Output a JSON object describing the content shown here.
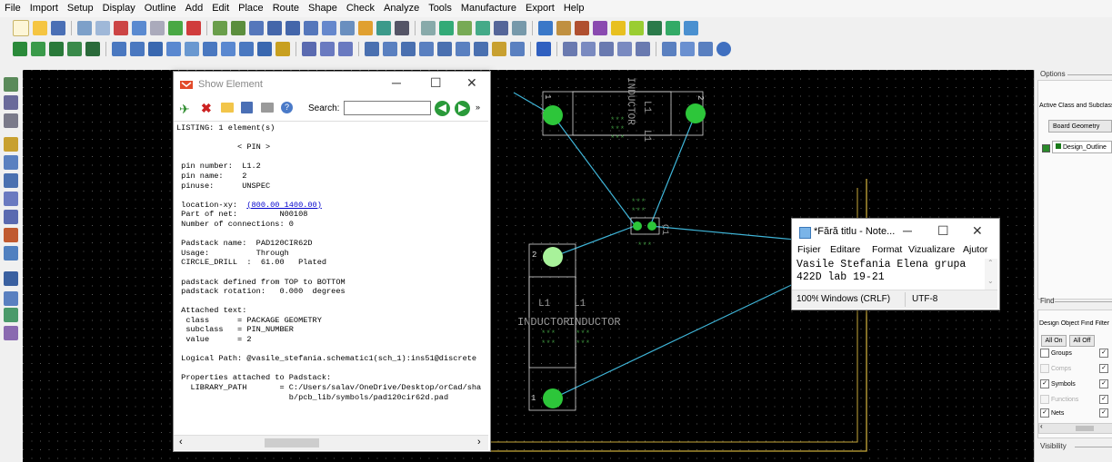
{
  "menu": [
    "File",
    "Import",
    "Setup",
    "Display",
    "Outline",
    "Add",
    "Edit",
    "Place",
    "Route",
    "Shape",
    "Check",
    "Analyze",
    "Tools",
    "Manufacture",
    "Export",
    "Help"
  ],
  "canvas": {
    "upper_inductor": {
      "label_left": "1",
      "label_right": "2",
      "ref_a": "L1",
      "ref_b": "L1",
      "type": "INDUCTOR",
      "marks": "***"
    },
    "lower_inductor": {
      "label_top": "2",
      "label_bottom": "1",
      "ref_a": "L1",
      "ref_b": "L1",
      "type_a": "INDUCTOR",
      "type_b": "INDUCTOR",
      "marks": "***"
    },
    "center_part": {
      "ref": "C1",
      "marks": "***"
    }
  },
  "show_element": {
    "title": "Show Element",
    "search_label": "Search:",
    "search_value": "",
    "lines": [
      {
        "t": "LISTING: 1 element(s)"
      },
      {
        "t": ""
      },
      {
        "t": "             < PIN >"
      },
      {
        "t": ""
      },
      {
        "t": " pin number:  L1.2"
      },
      {
        "t": " pin name:    2"
      },
      {
        "t": " pinuse:      UNSPEC"
      },
      {
        "t": ""
      },
      {
        "t": " location-xy:  ",
        "link": "(800.00 1400.00)"
      },
      {
        "t": " Part of net:         N00108"
      },
      {
        "t": " Number of connections: 0"
      },
      {
        "t": ""
      },
      {
        "t": " Padstack name:  PAD120CIR62D"
      },
      {
        "t": " Usage:          Through"
      },
      {
        "t": " CIRCLE_DRILL  :  61.00   Plated"
      },
      {
        "t": ""
      },
      {
        "t": " padstack defined from TOP to BOTTOM"
      },
      {
        "t": " padstack rotation:   0.000  degrees"
      },
      {
        "t": ""
      },
      {
        "t": " Attached text:"
      },
      {
        "t": "  class      = PACKAGE GEOMETRY"
      },
      {
        "t": "  subclass   = PIN_NUMBER"
      },
      {
        "t": "  value      = 2"
      },
      {
        "t": ""
      },
      {
        "t": " Logical Path: @vasile_stefania.schematic1(sch_1):ins51@discrete"
      },
      {
        "t": ""
      },
      {
        "t": " Properties attached to Padstack:"
      },
      {
        "t": "   LIBRARY_PATH       = C:/Users/salav/OneDrive/Desktop/orCad/sha"
      },
      {
        "t": "                        b/pcb_lib/symbols/pad120cir62d.pad"
      }
    ]
  },
  "notepad": {
    "title": "*Fără titlu - Note...",
    "menu": [
      "Fișier",
      "Editare",
      "Format",
      "Vizualizare",
      "Ajutor"
    ],
    "text_line1": "Vasile Stefania Elena grupa",
    "text_line2": "422D lab 19-21",
    "status": [
      "100%",
      "Windows (CRLF)",
      "UTF-8"
    ]
  },
  "options_panel": {
    "title": "Options",
    "active_class_label": "Active Class and Subclass",
    "class_button": "Board Geometry",
    "subclass_value": "Design_Outline"
  },
  "find_panel": {
    "title": "Find",
    "section": "Design Object Find Filter",
    "all_on": "All On",
    "all_off": "All Off",
    "items": [
      {
        "label": "Groups",
        "checked": false,
        "disabled": false
      },
      {
        "label": "Comps",
        "checked": false,
        "disabled": true
      },
      {
        "label": "Symbols",
        "checked": true,
        "disabled": false
      },
      {
        "label": "Functions",
        "checked": false,
        "disabled": true
      },
      {
        "label": "Nets",
        "checked": true,
        "disabled": false
      }
    ]
  },
  "visibility_panel": {
    "title": "Visibility"
  },
  "colors": {
    "pin": "#2dc63a",
    "pin_selected": "#a8f29a",
    "trace": "#3fb5d8",
    "outline": "#c8a93a",
    "silk": "#d8d8d8"
  }
}
